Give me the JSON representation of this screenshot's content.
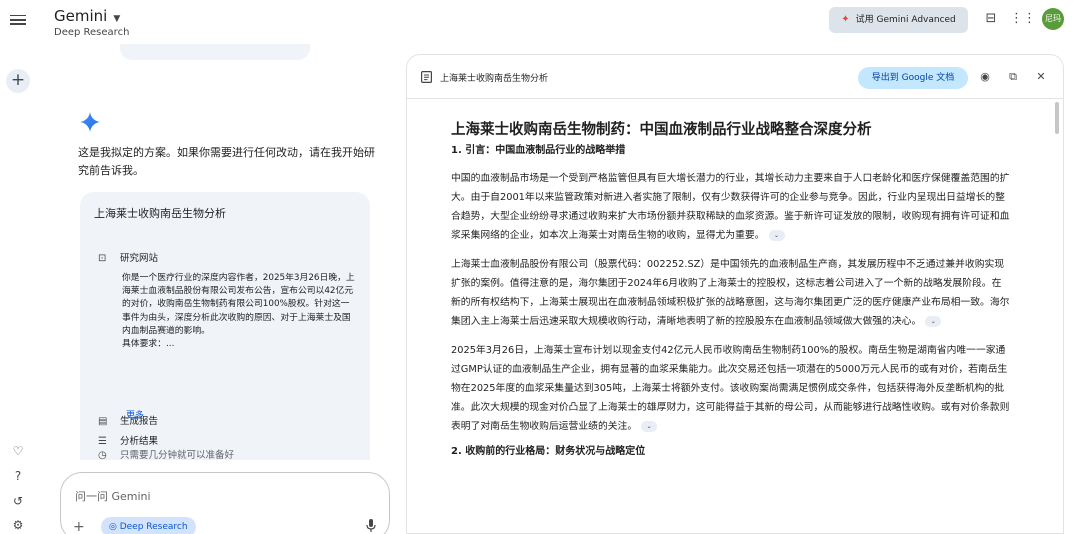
{
  "app": {
    "name": "Gemini",
    "mode": "Deep Research",
    "upgrade_button": "试用 Gemini Advanced",
    "avatar_text": "尼玛",
    "accent": "#0b57d0"
  },
  "chat": {
    "intro": "这是我拟定的方案。如果你需要进行任何改动，请在我开始研究前告诉我。",
    "plan": {
      "title": "上海莱士收购南岳生物分析",
      "steps": [
        {
          "icon": "globe-icon",
          "label": "研究网站"
        },
        {
          "icon": "analysis-icon",
          "label": "分析结果"
        },
        {
          "icon": "report-icon",
          "label": "生成报告"
        },
        {
          "icon": "clock-icon",
          "label": "只需要几分钟就可以准备好"
        }
      ],
      "step_detail": "你是一个医疗行业的深度内容作者，2025年3月26日晚，上海莱士血液制品股份有限公司发布公告，宣布公司以42亿元的对价，收购南岳生物制药有限公司100%股权。针对这一事件为由头，深度分析此次收购的原因、对于上海莱士及国内血制品赛道的影响。",
      "detail_tail": "具体要求：...",
      "more": "更多"
    },
    "compose": {
      "placeholder": "问一问 Gemini",
      "chip": "Deep Research"
    }
  },
  "report": {
    "panel_title": "上海莱士收购南岳生物分析",
    "export_button": "导出到 Google 文档",
    "title": "上海莱士收购南岳生物制药：中国血液制品行业战略整合深度分析",
    "section1": "1. 引言：中国血液制品行业的战略举措",
    "paragraphs": [
      "中国的血液制品市场是一个受到严格监管但具有巨大增长潜力的行业，其增长动力主要来自于人口老龄化和医疗保健覆盖范围的扩大。由于自2001年以来监管政策对新进入者实施了限制，仅有少数获得许可的企业参与竞争。因此，行业内呈现出日益增长的整合趋势，大型企业纷纷寻求通过收购来扩大市场份额并获取稀缺的血浆资源。鉴于新许可证发放的限制，收购现有拥有许可证和血浆采集网络的企业，如本次上海莱士对南岳生物的收购，显得尤为重要。",
      "上海莱士血液制品股份有限公司（股票代码：002252.SZ）是中国领先的血液制品生产商，其发展历程中不乏通过兼并收购实现扩张的案例。值得注意的是，海尔集团于2024年6月收购了上海莱士的控股权，这标志着公司进入了一个新的战略发展阶段。在新的所有权结构下，上海莱士展现出在血液制品领域积极扩张的战略意图，这与海尔集团更广泛的医疗健康产业布局相一致。海尔集团入主上海莱士后迅速采取大规模收购行动，清晰地表明了新的控股股东在血液制品领域做大做强的决心。",
      "2025年3月26日，上海莱士宣布计划以现金支付42亿元人民币收购南岳生物制药100%的股权。南岳生物是湖南省内唯一一家通过GMP认证的血液制品生产企业，拥有显著的血浆采集能力。此次交易还包括一项潜在的5000万元人民币的或有对价，若南岳生物在2025年度的血浆采集量达到305吨，上海莱士将额外支付。该收购案尚需满足惯例成交条件，包括获得海外反垄断机构的批准。此次大规模的现金对价凸显了上海莱士的雄厚财力，这可能得益于其新的母公司，从而能够进行战略性收购。或有对价条款则表明了对南岳生物收购后运营业绩的关注。"
    ],
    "section2": "2. 收购前的行业格局：财务状况与战略定位"
  }
}
